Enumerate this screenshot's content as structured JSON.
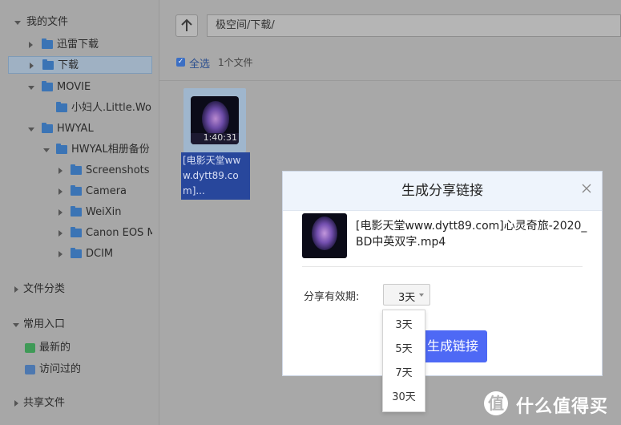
{
  "sidebar": {
    "root_label": "我的文件",
    "items": [
      {
        "label": "迅雷下载"
      },
      {
        "label": "下载"
      },
      {
        "label": "MOVIE"
      },
      {
        "label": "小妇人.Little.Wor"
      },
      {
        "label": "HWYAL"
      },
      {
        "label": "HWYAL相册备份"
      },
      {
        "label": "Screenshots"
      },
      {
        "label": "Camera"
      },
      {
        "label": "WeiXin"
      },
      {
        "label": "Canon EOS M"
      },
      {
        "label": "DCIM"
      }
    ],
    "file_categories": "文件分类",
    "common_entry": "常用入口",
    "recent": "最新的",
    "visited": "访问过的",
    "shared_files": "共享文件"
  },
  "toolbar": {
    "up_icon": "arrow-up-icon",
    "path": "极空间/下载/",
    "select_all": "全选",
    "file_count": "1个文件"
  },
  "file": {
    "duration": "1:40:31",
    "name": "[电影天堂www.dytt89.com]..."
  },
  "dialog": {
    "title": "生成分享链接",
    "file_name": "[电影天堂www.dytt89.com]心灵奇旅-2020_BD中英双字.mp4",
    "expiry_label": "分享有效期:",
    "expiry_value": "3天",
    "generate_button": "生成链接",
    "options": [
      "3天",
      "5天",
      "7天",
      "30天"
    ]
  },
  "watermark": {
    "glyph": "值",
    "text": "什么值得买"
  },
  "colors": {
    "accent": "#4e69f5",
    "folder": "#3b74b5",
    "selection": "#28479c"
  }
}
